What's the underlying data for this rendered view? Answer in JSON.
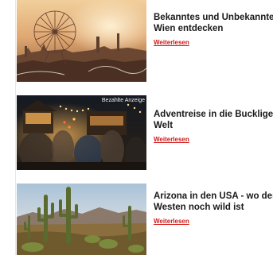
{
  "articles": [
    {
      "title_line1": "Bekanntes und Unbekanntes i",
      "title_line2": "Wien entdecken",
      "read_more": "Weiterlesen"
    },
    {
      "title_line1": "Adventreise in die Bucklige",
      "title_line2": "Welt",
      "read_more": "Weiterlesen",
      "badge": "Bezahlte Anzeige"
    },
    {
      "title_line1": "Arizona in den USA - wo der",
      "title_line2": "Westen noch wild ist",
      "read_more": "Weiterlesen"
    }
  ]
}
